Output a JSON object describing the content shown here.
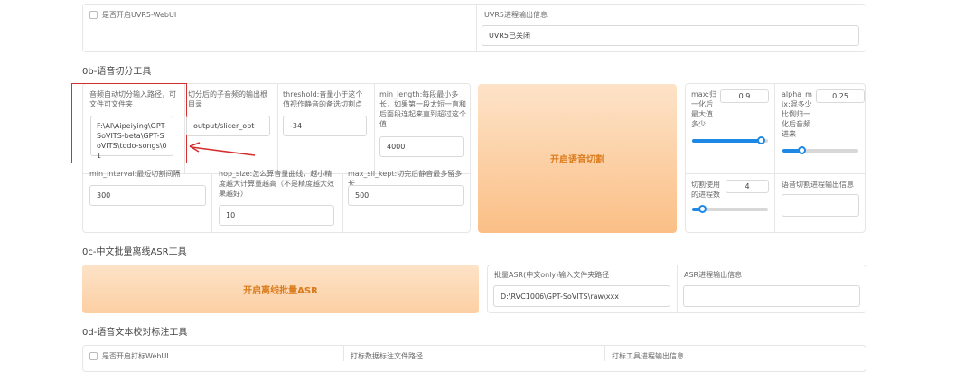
{
  "uvr5": {
    "checkbox_label": "是否开启UVR5-WebUI",
    "status_label": "UVR5进程输出信息",
    "status_value": "UVR5已关闭"
  },
  "slicer": {
    "section_title": "0b-语音切分工具",
    "input_path_label": "音频自动切分输入路径，可文件可文件夹",
    "input_path_value": "F:\\AI\\Aipeiying\\GPT-SoVITS-beta\\GPT-SoVITS\\todo-songs\\01",
    "output_dir_label": "切分后的子音频的输出根目录",
    "output_dir_value": "output/slicer_opt",
    "threshold_label": "threshold:音量小于这个值视作静音的备选切割点",
    "threshold_value": "-34",
    "min_length_label": "min_length:每段最小多长，如果第一段太短一直和后面段连起来直到超过这个值",
    "min_length_value": "4000",
    "min_interval_label": "min_interval:最短切割间隔",
    "min_interval_value": "300",
    "hop_size_label": "hop_size:怎么算音量曲线，越小精度越大计算量越高（不是精度越大效果越好）",
    "hop_size_value": "10",
    "max_sil_kept_label": "max_sil_kept:切完后静音最多留多长",
    "max_sil_kept_value": "500",
    "start_button": "开启语音切割",
    "max_label": "max:归一化后最大值多少",
    "max_value": "0.9",
    "max_fraction": 0.9,
    "alpha_label": "alpha_mix:混多少比例归一化后音频进来",
    "alpha_value": "0.25",
    "alpha_fraction": 0.25,
    "process_label": "切割使用的进程数",
    "process_value": "4",
    "output_info_label": "语音切割进程输出信息"
  },
  "asr": {
    "section_title": "0c-中文批量离线ASR工具",
    "start_button": "开启离线批量ASR",
    "input_label": "批量ASR(中文only)输入文件夹路径",
    "input_value": "D:\\RVC1006\\GPT-SoVITS\\raw\\xxx",
    "output_info_label": "ASR进程输出信息"
  },
  "proofread": {
    "section_title": "0d-语音文本校对标注工具",
    "checkbox_label": "是否开启打标WebUI",
    "path_label": "打标数据标注文件路径",
    "output_info_label": "打标工具进程输出信息"
  },
  "colors": {
    "button_orange": "#fbbf86",
    "button_orange_light": "#fde3c8",
    "button_text": "#d97a1a",
    "slider_blue": "#1e88e5",
    "annotation_red": "#d32f2f"
  }
}
